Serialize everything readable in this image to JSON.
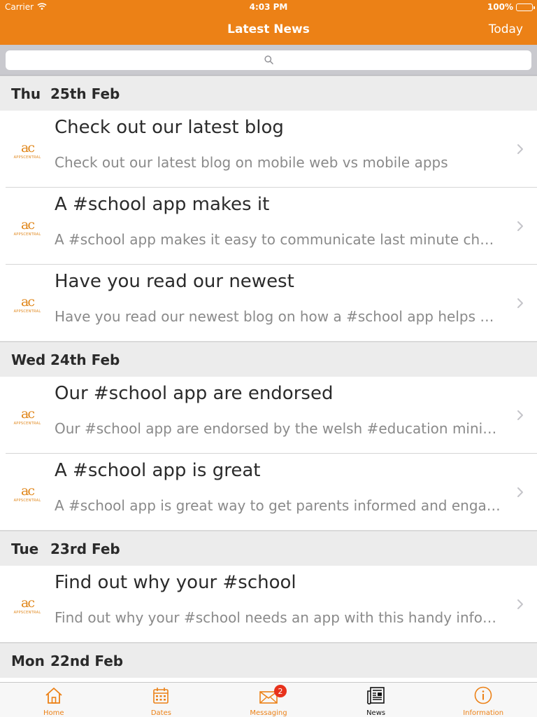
{
  "status_bar": {
    "carrier": "Carrier",
    "time": "4:03 PM",
    "battery": "100%"
  },
  "nav": {
    "title": "Latest News",
    "today_label": "Today"
  },
  "search": {
    "placeholder": ""
  },
  "sections": [
    {
      "day": "Thu",
      "date": "25th Feb",
      "items": [
        {
          "title": "Check out our latest blog",
          "subtitle": "Check out our latest blog on mobile web vs mobile apps"
        },
        {
          "title": "A #school app makes it",
          "subtitle": "A #school app makes it easy to communicate last minute chan…"
        },
        {
          "title": "Have you read our newest",
          "subtitle": "Have you read our newest blog on how a #school app helps #…"
        }
      ]
    },
    {
      "day": "Wed",
      "date": "24th Feb",
      "items": [
        {
          "title": "Our #school app are endorsed",
          "subtitle": "Our #school app are endorsed by the welsh #education minister"
        },
        {
          "title": "A #school app is great",
          "subtitle": "A #school app is great way to get parents informed and enga…"
        }
      ]
    },
    {
      "day": "Tue",
      "date": "23rd Feb",
      "items": [
        {
          "title": "Find out why your #school",
          "subtitle": "Find out why your #school needs an app with this handy infogr…"
        }
      ]
    },
    {
      "day": "Mon",
      "date": "22nd Feb",
      "items": []
    }
  ],
  "tabs": [
    {
      "label": "Home",
      "icon": "home-icon"
    },
    {
      "label": "Dates",
      "icon": "calendar-icon"
    },
    {
      "label": "Messaging",
      "icon": "envelope-icon",
      "badge": "2"
    },
    {
      "label": "News",
      "icon": "newspaper-icon",
      "active": true
    },
    {
      "label": "Information",
      "icon": "info-icon"
    }
  ],
  "colors": {
    "accent": "#ec8116",
    "badge": "#e8321c"
  }
}
